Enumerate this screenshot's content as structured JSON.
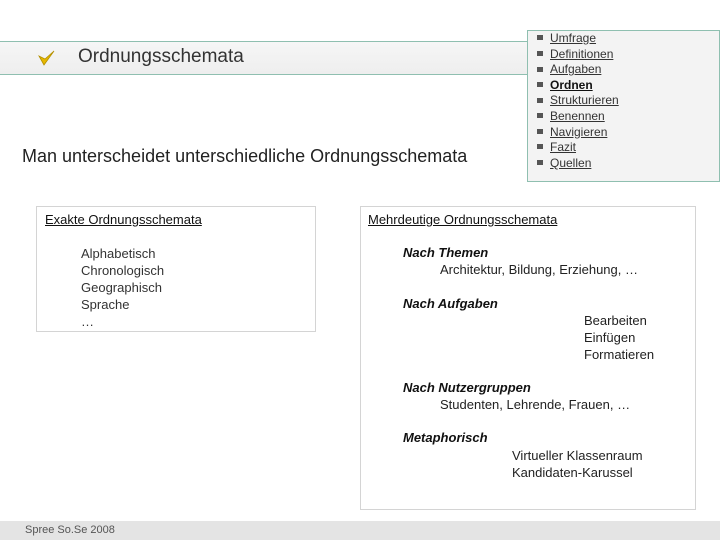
{
  "header": {
    "title": "Ordnungsschemata",
    "icon": "checkmark-arrow-icon"
  },
  "nav": {
    "items": [
      {
        "label": "Umfrage",
        "active": false
      },
      {
        "label": "Definitionen",
        "active": false
      },
      {
        "label": "Aufgaben",
        "active": false
      },
      {
        "label": "Ordnen",
        "active": true
      },
      {
        "label": "Strukturieren",
        "active": false
      },
      {
        "label": "Benennen",
        "active": false
      },
      {
        "label": "Navigieren",
        "active": false
      },
      {
        "label": "Fazit",
        "active": false
      },
      {
        "label": "Quellen",
        "active": false
      }
    ]
  },
  "subtitle": "Man unterscheidet unterschiedliche Ordnungsschemata",
  "left_box": {
    "heading": "Exakte Ordnungsschemata",
    "items": [
      "Alphabetisch",
      "Chronologisch",
      "Geographisch",
      "Sprache",
      "…"
    ]
  },
  "right_box": {
    "heading": "Mehrdeutige Ordnungsschemata",
    "groups": [
      {
        "title": "Nach Themen",
        "values": [
          "Architektur, Bildung, Erziehung, …"
        ]
      },
      {
        "title": "Nach Aufgaben",
        "values": [
          "Bearbeiten",
          "Einfügen",
          "Formatieren"
        ]
      },
      {
        "title": "Nach Nutzergruppen",
        "values": [
          "Studenten, Lehrende, Frauen, …"
        ]
      },
      {
        "title": "Metaphorisch",
        "values": [
          "Virtueller Klassenraum",
          "Kandidaten-Karussel"
        ]
      }
    ]
  },
  "footer": {
    "text": "Spree So.Se 2008"
  },
  "colors": {
    "accent": "#8fbfb0",
    "icon": "#e6b800"
  }
}
